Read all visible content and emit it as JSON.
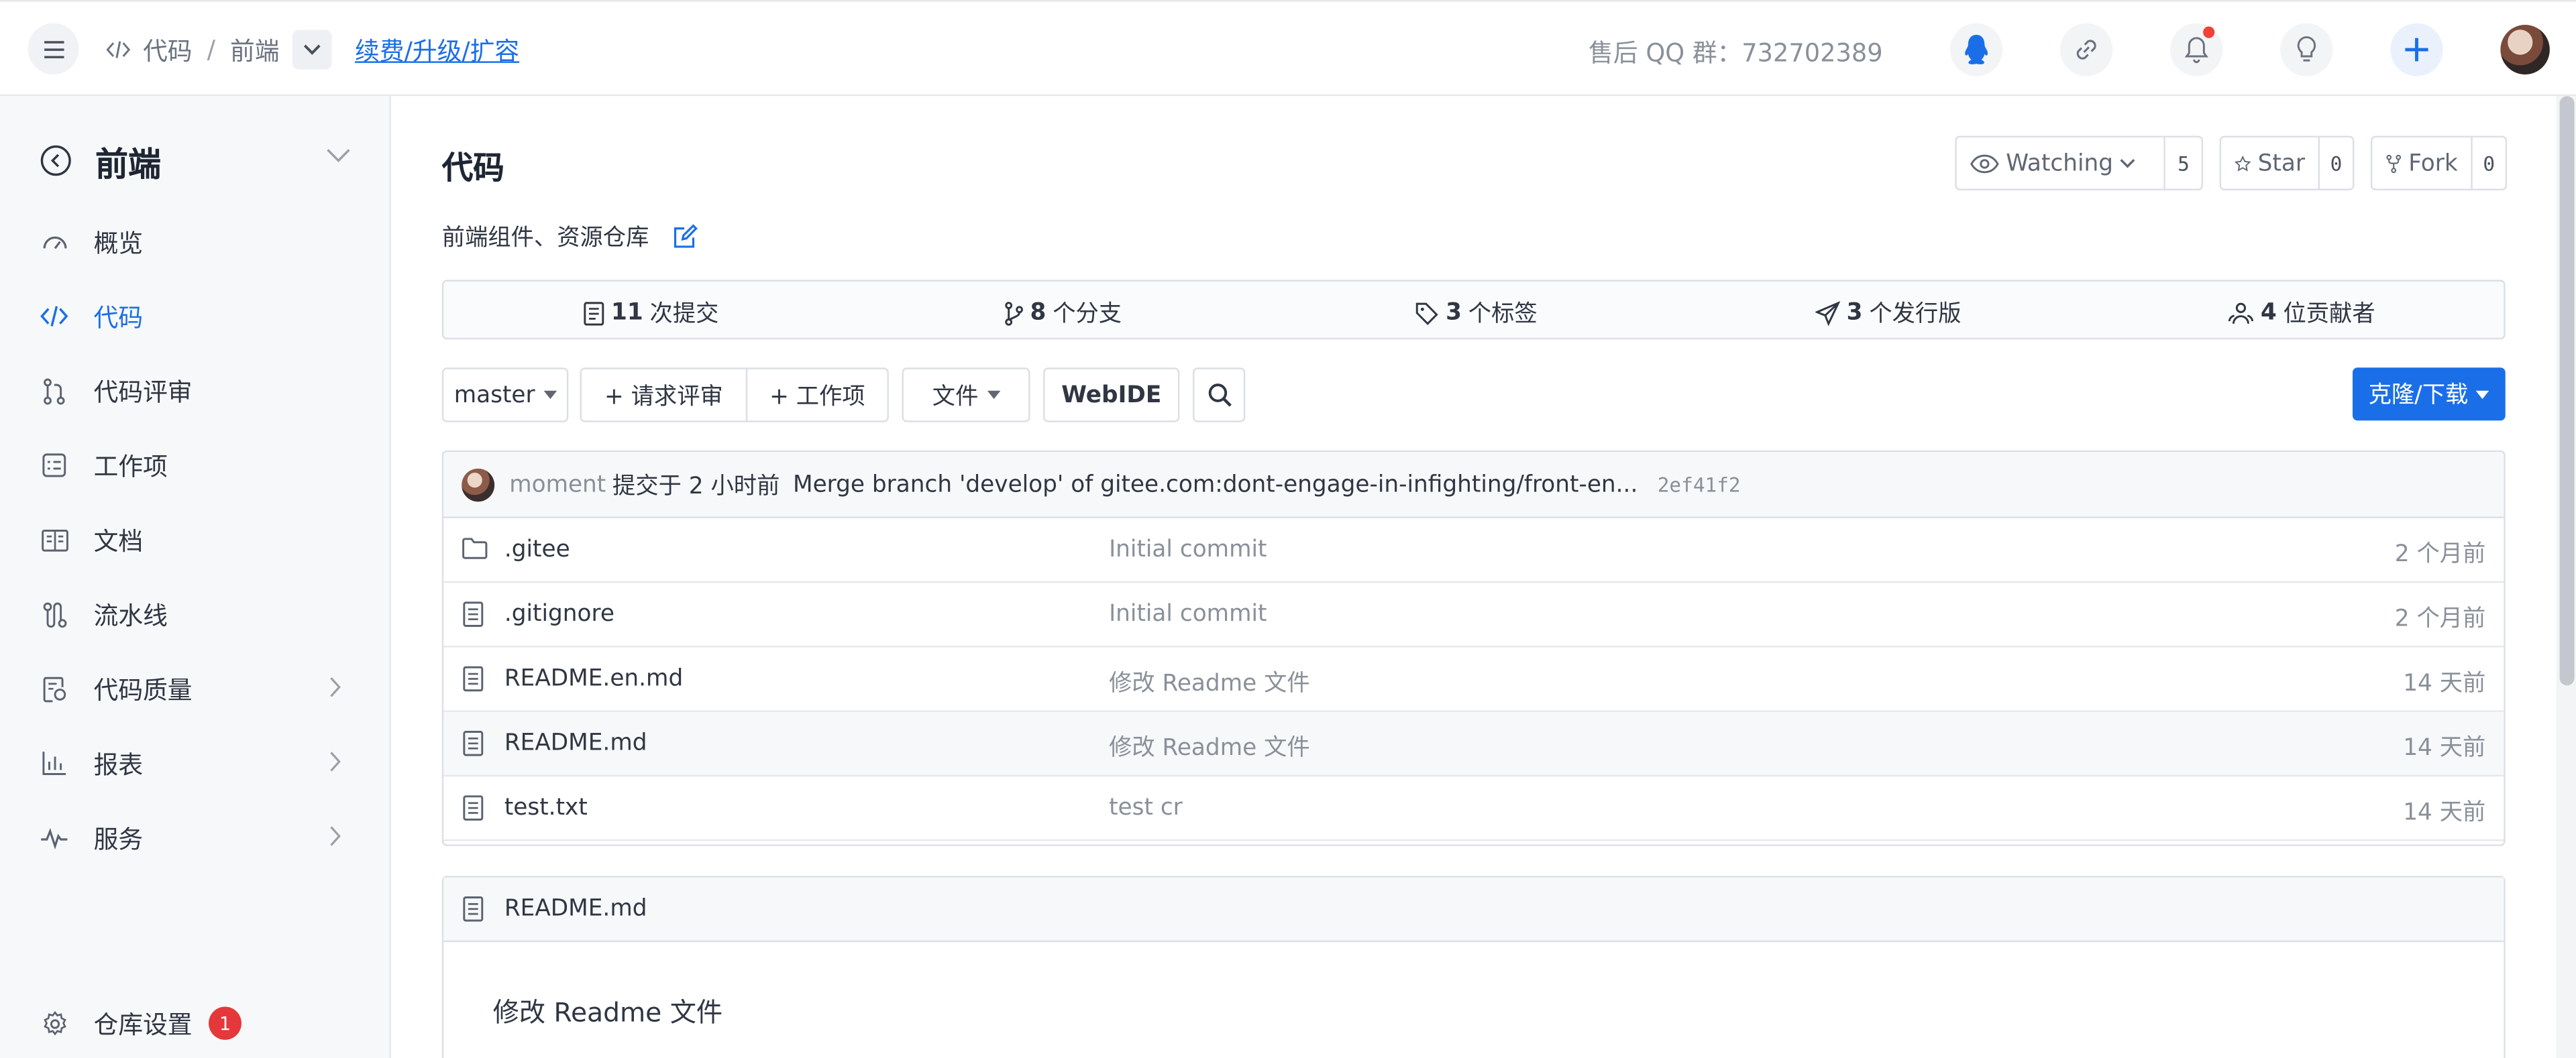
{
  "topbar": {
    "breadcrumb": [
      "代码",
      "前端"
    ],
    "breadcrumb_sep": "/",
    "upgrade_link": "续费/升级/扩容",
    "qq_group": "售后 QQ 群：732702389"
  },
  "sidebar": {
    "project_title": "前端",
    "items": [
      {
        "label": "概览",
        "icon": "gauge-icon"
      },
      {
        "label": "代码",
        "icon": "code-icon",
        "active": true
      },
      {
        "label": "代码评审",
        "icon": "pull-request-icon"
      },
      {
        "label": "工作项",
        "icon": "task-list-icon"
      },
      {
        "label": "文档",
        "icon": "document-icon"
      },
      {
        "label": "流水线",
        "icon": "pipeline-icon"
      },
      {
        "label": "代码质量",
        "icon": "quality-icon"
      },
      {
        "label": "报表",
        "icon": "bar-chart-icon"
      },
      {
        "label": "服务",
        "icon": "pulse-icon"
      }
    ],
    "settings": {
      "label": "仓库设置",
      "badge": "1"
    }
  },
  "repo": {
    "title": "代码",
    "description": "前端组件、资源仓库",
    "watch": {
      "label": "Watching",
      "count": "5"
    },
    "star": {
      "label": "Star",
      "count": "0"
    },
    "fork": {
      "label": "Fork",
      "count": "0"
    }
  },
  "stats": {
    "commits": {
      "num": "11",
      "label": "次提交"
    },
    "branches": {
      "num": "8",
      "label": "个分支"
    },
    "tags": {
      "num": "3",
      "label": "个标签"
    },
    "releases": {
      "num": "3",
      "label": "个发行版"
    },
    "contributors": {
      "num": "4",
      "label": "位贡献者"
    }
  },
  "toolbar": {
    "branch": "master",
    "new_pr": "+ 请求评审",
    "new_issue": "+ 工作项",
    "file_menu": "文件",
    "webide": "WebIDE",
    "clone": "克隆/下载"
  },
  "commit": {
    "author": "moment",
    "time": "提交于 2 小时前",
    "message": "Merge branch 'develop' of gitee.com:dont-engage-in-infighting/front-en...",
    "sha": "2ef41f2"
  },
  "files": [
    {
      "name": ".gitee",
      "type": "folder",
      "message": "Initial commit",
      "time": "2 个月前"
    },
    {
      "name": ".gitignore",
      "type": "file",
      "message": "Initial commit",
      "time": "2 个月前"
    },
    {
      "name": "README.en.md",
      "type": "file",
      "message": "修改 Readme 文件",
      "time": "14 天前"
    },
    {
      "name": "README.md",
      "type": "file",
      "message": "修改 Readme 文件",
      "time": "14 天前"
    },
    {
      "name": "test.txt",
      "type": "file",
      "message": "test cr",
      "time": "14 天前"
    }
  ],
  "readme": {
    "filename": "README.md",
    "content": "修改 Readme 文件"
  },
  "colors": {
    "accent": "#1a6fe8",
    "badge": "#e5383b",
    "notification_dot": "#f04134"
  }
}
